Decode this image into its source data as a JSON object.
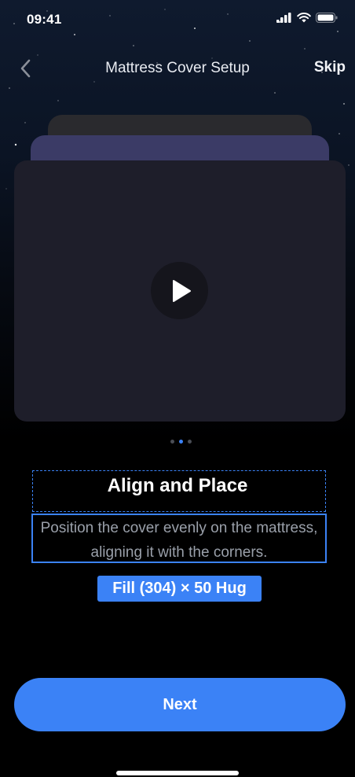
{
  "status_bar": {
    "time": "09:41"
  },
  "nav": {
    "title": "Mattress Cover Setup",
    "skip_label": "Skip"
  },
  "carousel": {
    "page_count": 3,
    "active_index": 1
  },
  "step": {
    "title": "Align and Place",
    "description": "Position the cover evenly on the mattress, aligning it with the corners."
  },
  "size_tag": "Fill (304) × 50 Hug",
  "next_label": "Next",
  "colors": {
    "accent": "#3b82f6",
    "card": "#1e1e2a",
    "background": "#000000"
  },
  "icons": [
    "signal-icon",
    "wifi-icon",
    "battery-icon",
    "chevron-left-icon",
    "play-icon"
  ]
}
